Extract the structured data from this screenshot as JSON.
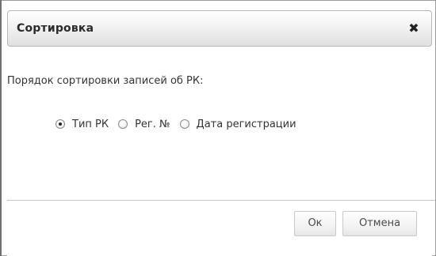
{
  "dialog": {
    "title": "Сортировка",
    "close_glyph": "✖",
    "close_icon": "close-icon"
  },
  "sort": {
    "prompt": "Порядок сортировки записей об РК:",
    "options": [
      {
        "label": "Тип РК",
        "selected": true
      },
      {
        "label": "Рег. №",
        "selected": false
      },
      {
        "label": "Дата регистрации",
        "selected": false
      }
    ]
  },
  "buttons": {
    "ok_label": "Ок",
    "cancel_label": "Отмена"
  }
}
